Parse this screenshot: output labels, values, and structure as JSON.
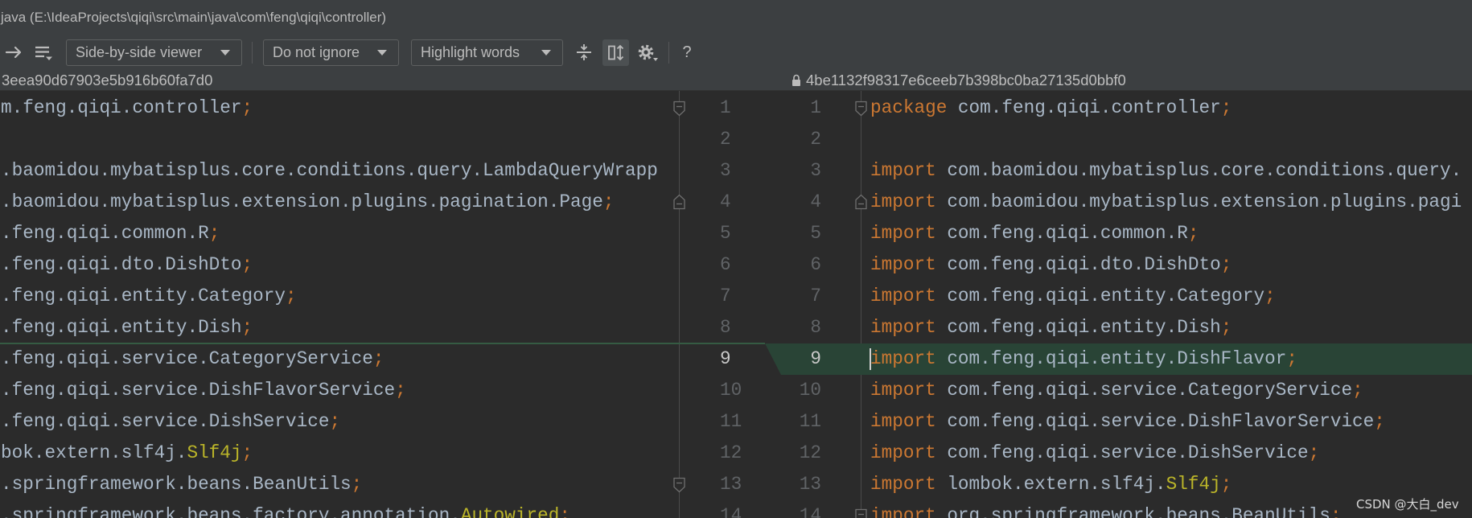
{
  "window": {
    "title": "java (E:\\IdeaProjects\\qiqi\\src\\main\\java\\com\\feng\\qiqi\\controller)"
  },
  "toolbar": {
    "icons": {
      "next_difference": "arrow-right-icon",
      "menu": "list-menu-icon",
      "collapse_unchanged": "collapse-unchanged-icon",
      "synchronize_scrolling": "sync-scroll-icon",
      "settings": "gear-icon",
      "help": "help-icon"
    },
    "viewer_mode": "Side-by-side viewer",
    "ignore_mode": "Do not ignore",
    "highlight_mode": "Highlight words",
    "help_label": "?",
    "sync_scroll_active": true
  },
  "left": {
    "revision": "3eea90d67903e5b916b60fa7d0",
    "lines": [
      {
        "n": "1",
        "fold": "start",
        "tokens": [
          {
            "t": "m.feng.qiqi.controller",
            "c": "id"
          },
          {
            "t": ";",
            "c": "semi"
          }
        ]
      },
      {
        "n": "2",
        "tokens": []
      },
      {
        "n": "3",
        "tokens": [
          {
            "t": ".baomidou.mybatisplus.core.conditions.query.LambdaQueryWrapp",
            "c": "id"
          }
        ]
      },
      {
        "n": "4",
        "fold": "end",
        "tokens": [
          {
            "t": ".baomidou.mybatisplus.extension.plugins.pagination.Page",
            "c": "id"
          },
          {
            "t": ";",
            "c": "semi"
          }
        ]
      },
      {
        "n": "5",
        "tokens": [
          {
            "t": ".feng.qiqi.common.R",
            "c": "id"
          },
          {
            "t": ";",
            "c": "semi"
          }
        ]
      },
      {
        "n": "6",
        "tokens": [
          {
            "t": ".feng.qiqi.dto.DishDto",
            "c": "id"
          },
          {
            "t": ";",
            "c": "semi"
          }
        ]
      },
      {
        "n": "7",
        "tokens": [
          {
            "t": ".feng.qiqi.entity.Category",
            "c": "id"
          },
          {
            "t": ";",
            "c": "semi"
          }
        ]
      },
      {
        "n": "8",
        "tokens": [
          {
            "t": ".feng.qiqi.entity.Dish",
            "c": "id"
          },
          {
            "t": ";",
            "c": "semi"
          }
        ]
      },
      {
        "n": "9",
        "current": true,
        "tokens": [
          {
            "t": ".feng.qiqi.service.CategoryService",
            "c": "id"
          },
          {
            "t": ";",
            "c": "semi"
          }
        ]
      },
      {
        "n": "10",
        "tokens": [
          {
            "t": ".feng.qiqi.service.DishFlavorService",
            "c": "id"
          },
          {
            "t": ";",
            "c": "semi"
          }
        ]
      },
      {
        "n": "11",
        "tokens": [
          {
            "t": ".feng.qiqi.service.DishService",
            "c": "id"
          },
          {
            "t": ";",
            "c": "semi"
          }
        ]
      },
      {
        "n": "12",
        "tokens": [
          {
            "t": "bok.extern.slf4j.",
            "c": "id"
          },
          {
            "t": "Slf4j",
            "c": "ann"
          },
          {
            "t": ";",
            "c": "semi"
          }
        ]
      },
      {
        "n": "13",
        "fold": "start",
        "tokens": [
          {
            "t": ".springframework.beans.BeanUtils",
            "c": "id"
          },
          {
            "t": ";",
            "c": "semi"
          }
        ]
      },
      {
        "n": "14",
        "tokens": [
          {
            "t": ".springframework.beans.factory.annotation.",
            "c": "id"
          },
          {
            "t": "Autowired",
            "c": "ann"
          },
          {
            "t": ";",
            "c": "semi"
          }
        ]
      }
    ]
  },
  "right": {
    "revision": "4be1132f98317e6ceeb7b398bc0ba27135d0bbf0",
    "read_only_icon": "lock-icon",
    "lines": [
      {
        "n": "1",
        "fold": "start",
        "tokens": [
          {
            "t": "package",
            "c": "kw"
          },
          {
            "t": " com.feng.qiqi.controller",
            "c": "id"
          },
          {
            "t": ";",
            "c": "semi"
          }
        ]
      },
      {
        "n": "2",
        "tokens": []
      },
      {
        "n": "3",
        "tokens": [
          {
            "t": "import",
            "c": "kw"
          },
          {
            "t": " com.baomidou.mybatisplus.core.conditions.query.",
            "c": "id"
          }
        ]
      },
      {
        "n": "4",
        "fold": "end",
        "tokens": [
          {
            "t": "import",
            "c": "kw"
          },
          {
            "t": " com.baomidou.mybatisplus.extension.plugins.pagi",
            "c": "id"
          }
        ]
      },
      {
        "n": "5",
        "tokens": [
          {
            "t": "import",
            "c": "kw"
          },
          {
            "t": " com.feng.qiqi.common.R",
            "c": "id"
          },
          {
            "t": ";",
            "c": "semi"
          }
        ]
      },
      {
        "n": "6",
        "tokens": [
          {
            "t": "import",
            "c": "kw"
          },
          {
            "t": " com.feng.qiqi.dto.DishDto",
            "c": "id"
          },
          {
            "t": ";",
            "c": "semi"
          }
        ]
      },
      {
        "n": "7",
        "tokens": [
          {
            "t": "import",
            "c": "kw"
          },
          {
            "t": " com.feng.qiqi.entity.Category",
            "c": "id"
          },
          {
            "t": ";",
            "c": "semi"
          }
        ]
      },
      {
        "n": "8",
        "tokens": [
          {
            "t": "import",
            "c": "kw"
          },
          {
            "t": " com.feng.qiqi.entity.Dish",
            "c": "id"
          },
          {
            "t": ";",
            "c": "semi"
          }
        ]
      },
      {
        "n": "9",
        "current": true,
        "inserted": true,
        "caret": true,
        "tokens": [
          {
            "t": "import",
            "c": "kw"
          },
          {
            "t": " com.feng.qiqi.entity.DishFlavor",
            "c": "id"
          },
          {
            "t": ";",
            "c": "semi"
          }
        ]
      },
      {
        "n": "10",
        "tokens": [
          {
            "t": "import",
            "c": "kw"
          },
          {
            "t": " com.feng.qiqi.service.CategoryService",
            "c": "id"
          },
          {
            "t": ";",
            "c": "semi"
          }
        ]
      },
      {
        "n": "11",
        "tokens": [
          {
            "t": "import",
            "c": "kw"
          },
          {
            "t": " com.feng.qiqi.service.DishFlavorService",
            "c": "id"
          },
          {
            "t": ";",
            "c": "semi"
          }
        ]
      },
      {
        "n": "12",
        "tokens": [
          {
            "t": "import",
            "c": "kw"
          },
          {
            "t": " com.feng.qiqi.service.DishService",
            "c": "id"
          },
          {
            "t": ";",
            "c": "semi"
          }
        ]
      },
      {
        "n": "13",
        "tokens": [
          {
            "t": "import",
            "c": "kw"
          },
          {
            "t": " lombok.extern.slf4j.",
            "c": "id"
          },
          {
            "t": "Slf4j",
            "c": "ann"
          },
          {
            "t": ";",
            "c": "semi"
          }
        ]
      },
      {
        "n": "14",
        "fold": "start",
        "tokens": [
          {
            "t": "import",
            "c": "kw"
          },
          {
            "t": " org.springframework.beans.BeanUtils",
            "c": "id"
          },
          {
            "t": ";",
            "c": "semi"
          }
        ]
      }
    ]
  },
  "colors": {
    "editor_background": "#2b2b2b",
    "panel_background": "#3c3f41",
    "code_text": "#a9b7c6",
    "keyword": "#cc7832",
    "annotation": "#bbb529",
    "line_number": "#606366",
    "current_line_number": "#c8c8c8",
    "inserted_background": "#294436",
    "ui_text": "#bbbbbb"
  },
  "watermark": "CSDN @大白_dev"
}
